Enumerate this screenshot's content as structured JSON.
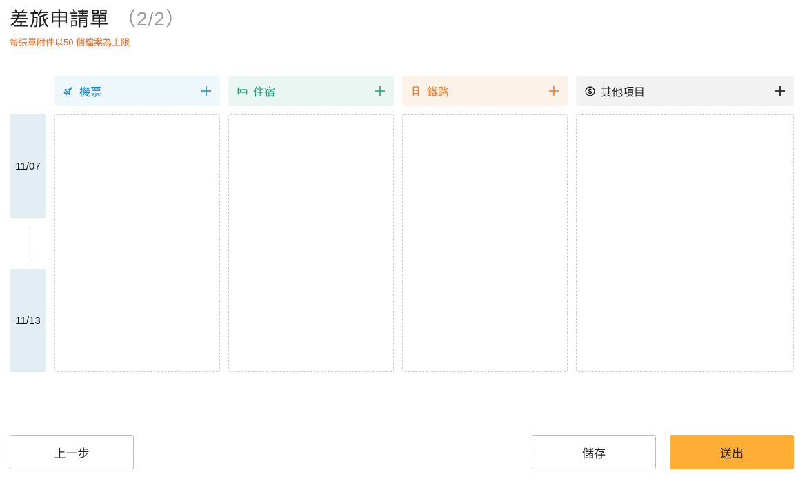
{
  "header": {
    "title": "差旅申請單",
    "step": "（2/2）",
    "limit_note": "每張單附件以50 個檔案為上限"
  },
  "columns": [
    {
      "label": "機票",
      "icon": "airplane-icon",
      "color": "#1a8ad0"
    },
    {
      "label": "住宿",
      "icon": "bed-icon",
      "color": "#16a579"
    },
    {
      "label": "鐵路",
      "icon": "train-icon",
      "color": "#ef7a26"
    },
    {
      "label": "其他項目",
      "icon": "dollar-circle-icon",
      "color": "#222222"
    }
  ],
  "dates": {
    "start": "11/07",
    "end": "11/13"
  },
  "actions": {
    "prev_label": "上一步",
    "save_label": "儲存",
    "submit_label": "送出"
  },
  "colors": {
    "accent": "#ffae35",
    "note": "#f0621a",
    "date_badge_bg": "#e3edf4"
  }
}
